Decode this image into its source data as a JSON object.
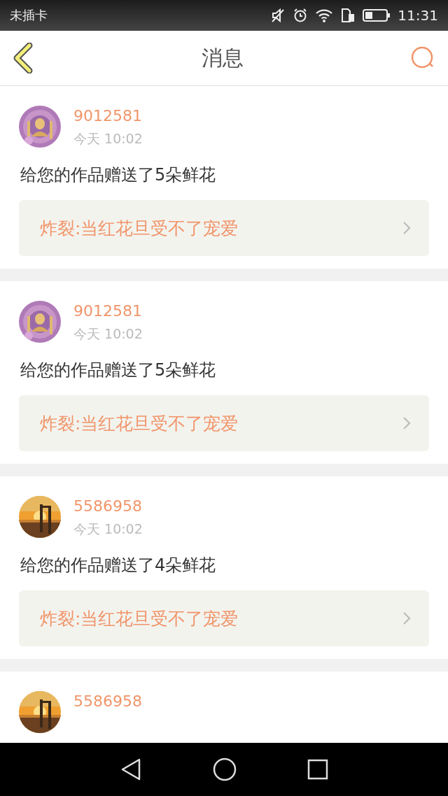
{
  "status_bar": {
    "carrier": "未插卡",
    "time": "11:31"
  },
  "header": {
    "title": "消息"
  },
  "messages": [
    {
      "name": "9012581",
      "time": "今天 10:02",
      "text": "给您的作品赠送了5朵鲜花",
      "work": "炸裂:当红花旦受不了宠爱"
    },
    {
      "name": "9012581",
      "time": "今天 10:02",
      "text": "给您的作品赠送了5朵鲜花",
      "work": "炸裂:当红花旦受不了宠爱"
    },
    {
      "name": "5586958",
      "time": "今天 10:02",
      "text": "给您的作品赠送了4朵鲜花",
      "work": "炸裂:当红花旦受不了宠爱"
    },
    {
      "name": "5586958"
    }
  ]
}
